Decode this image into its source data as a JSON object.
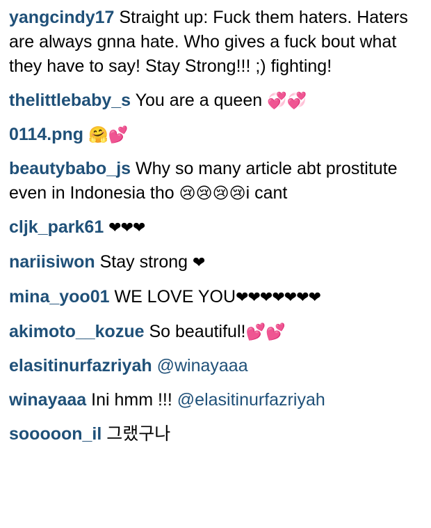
{
  "comments": [
    {
      "user": "yangcindy17",
      "text": "Straight up: Fuck them haters. Haters are always gnna hate. Who gives a fuck bout what they have to say! Stay Strong!!! ;) fighting!",
      "emoji": ""
    },
    {
      "user": "thelittlebaby_s",
      "text": "You are a queen",
      "emoji": "💞💞"
    },
    {
      "user": "0114.png",
      "text": "",
      "emoji": "🤗💕"
    },
    {
      "user": "beautybabo_js",
      "text": "Why so many article abt prostitute even in Indonesia tho",
      "emoji": "😢😢😢😢",
      "tail": "i cant"
    },
    {
      "user": "cljk_park61",
      "text": "",
      "emoji": "❤❤❤"
    },
    {
      "user": "nariisiwon",
      "text": "Stay strong",
      "emoji": "❤"
    },
    {
      "user": "mina_yoo01",
      "text": "WE LOVE YOU",
      "emoji": "❤❤❤❤❤❤❤"
    },
    {
      "user": "akimoto__kozue",
      "text": "So beautiful!",
      "emoji": "💕💕"
    },
    {
      "user": "elasitinurfazriyah",
      "text": "",
      "mention": "@winayaaa"
    },
    {
      "user": "winayaaa",
      "text": "Ini hmm !!!",
      "mention": "@elasitinurfazriyah"
    },
    {
      "user": "sooooon_il",
      "text": "그랬구나"
    }
  ],
  "colors": {
    "username": "#1f5078",
    "text": "#000000",
    "background": "#ffffff"
  }
}
